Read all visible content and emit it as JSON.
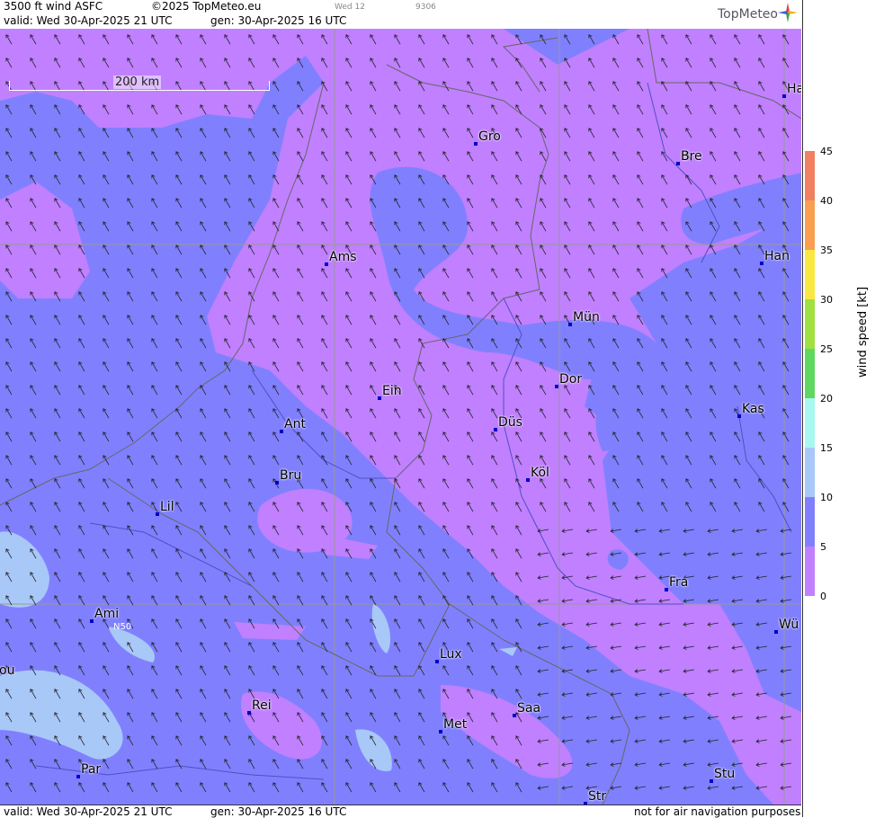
{
  "header": {
    "product": "3500 ft wind ASFC",
    "copyright": "©2025 TopMeteo.eu",
    "valid": "valid:  Wed  30-Apr-2025  21 UTC",
    "gen": "gen:  30-Apr-2025 16 UTC",
    "faint_day": "Wed 12",
    "faint_code": "9306"
  },
  "logo": "TopMeteo",
  "scale_bar": "200 km",
  "latitude_label": "N50",
  "footer": {
    "valid": "valid:  Wed  30-Apr-2025  21 UTC",
    "gen": "gen: 30-Apr-2025 16 UTC",
    "disclaimer": "not for air navigation purposes"
  },
  "legend": {
    "title": "wind  speed  [kt]",
    "ticks": [
      "45",
      "40",
      "35",
      "30",
      "25",
      "20",
      "15",
      "10",
      "5",
      "0"
    ],
    "colors": [
      "#f08060",
      "#f8a050",
      "#f8e840",
      "#a0e040",
      "#60d860",
      "#a8f8f0",
      "#a8c8f8",
      "#8080ff",
      "#c080ff"
    ]
  },
  "cities": [
    {
      "name": "Gro"
    },
    {
      "name": "Bre"
    },
    {
      "name": "Ha"
    },
    {
      "name": "Ams"
    },
    {
      "name": "Han"
    },
    {
      "name": "Mün"
    },
    {
      "name": "Dor"
    },
    {
      "name": "Ein"
    },
    {
      "name": "Kas"
    },
    {
      "name": "Ant"
    },
    {
      "name": "Düs"
    },
    {
      "name": "Köl"
    },
    {
      "name": "Bru"
    },
    {
      "name": "Lil"
    },
    {
      "name": "Fra"
    },
    {
      "name": "Ami"
    },
    {
      "name": "Wü"
    },
    {
      "name": "Lux"
    },
    {
      "name": "ou"
    },
    {
      "name": "Saa"
    },
    {
      "name": "Rei"
    },
    {
      "name": "Met"
    },
    {
      "name": "Par"
    },
    {
      "name": "Stu"
    },
    {
      "name": "Str"
    }
  ]
}
